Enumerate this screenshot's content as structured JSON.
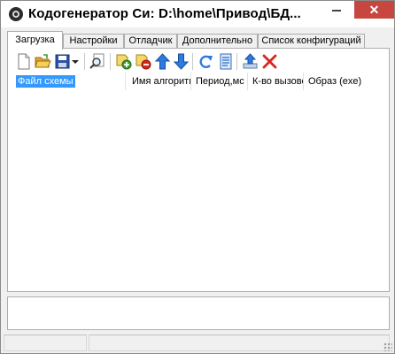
{
  "window": {
    "title": "Кодогенератор Си: D:\\home\\Привод\\БД...",
    "close_glyph": "✕"
  },
  "tabs": [
    {
      "label": "Загрузка",
      "active": true
    },
    {
      "label": "Настройки",
      "active": false
    },
    {
      "label": "Отладчик",
      "active": false
    },
    {
      "label": "Дополнительно",
      "active": false
    },
    {
      "label": "Список конфигураций",
      "active": false
    }
  ],
  "toolbar": {
    "icons": [
      "new-file-icon",
      "open-folder-icon",
      "save-icon",
      "dropdown-arrow-icon",
      "search-icon",
      "add-icon",
      "remove-icon",
      "move-up-icon",
      "move-down-icon",
      "refresh-icon",
      "document-list-icon",
      "export-icon",
      "delete-icon"
    ]
  },
  "list": {
    "columns": [
      "Файл схемы",
      "Имя алгоритм",
      "Период,мс",
      "К-во вызово",
      "Образ (exe)"
    ],
    "rows": []
  },
  "colors": {
    "selection": "#3399ff",
    "close_button": "#c7463f",
    "icon_green": "#3d9c2e",
    "icon_blue": "#2d7be0",
    "icon_red": "#d9261c",
    "icon_yellow": "#f2b705"
  }
}
